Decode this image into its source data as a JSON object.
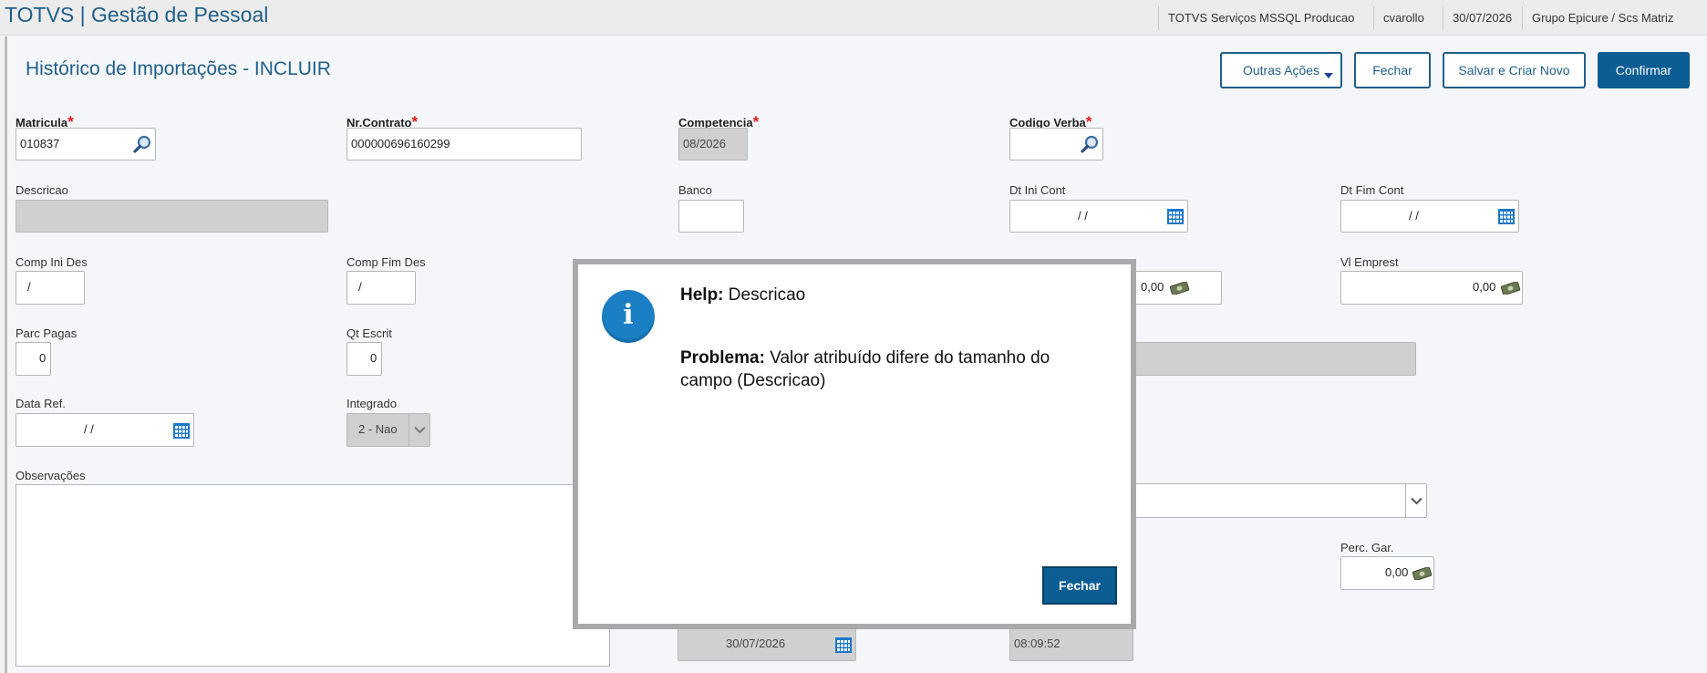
{
  "app": {
    "title": "TOTVS | Gestão de Pessoal",
    "status": [
      "TOTVS Serviços MSSQL Producao",
      "cvarollo",
      "30/07/2026",
      "Grupo Epicure / Scs Matriz"
    ]
  },
  "page": {
    "title": "Histórico de Importações - INCLUIR"
  },
  "toolbar": {
    "other_actions": "Outras Ações",
    "close": "Fechar",
    "save_new": "Salvar e Criar Novo",
    "confirm": "Confirmar"
  },
  "form": {
    "matricula": {
      "label": "Matricula",
      "value": "010837"
    },
    "nr_contrato": {
      "label": "Nr.Contrato",
      "value": "000000696160299"
    },
    "competencia": {
      "label": "Competencia",
      "value": "08/2026"
    },
    "codigo_verba": {
      "label": "Codigo Verba",
      "value": ""
    },
    "descricao": {
      "label": "Descricao",
      "value": ""
    },
    "banco": {
      "label": "Banco",
      "value": ""
    },
    "dt_ini_cont": {
      "label": "Dt Ini Cont",
      "value": "/ /"
    },
    "dt_fim_cont": {
      "label": "Dt Fim Cont",
      "value": "/ /"
    },
    "comp_ini_des": {
      "label": "Comp Ini Des",
      "value": "/"
    },
    "comp_fim_des": {
      "label": "Comp Fim Des",
      "value": "/"
    },
    "vl_prest_partial": {
      "value": "0,00"
    },
    "vl_emprest": {
      "label": "Vl Emprest",
      "value": "0,00"
    },
    "parc_pagas": {
      "label": "Parc Pagas",
      "value": "0"
    },
    "qt_escrit": {
      "label": "Qt Escrit",
      "value": "0"
    },
    "data_ref": {
      "label": "Data Ref.",
      "value": "/ /"
    },
    "integrado": {
      "label": "Integrado",
      "value": "2 - Nao"
    },
    "observacoes": {
      "label": "Observações",
      "value": ""
    },
    "perc_gar": {
      "label": "Perc. Gar.",
      "value": "0,00"
    },
    "data_bottom": {
      "value": "30/07/2026"
    },
    "hora_bottom": {
      "value": "08:09:52"
    }
  },
  "modal": {
    "help_label": "Help:",
    "help_value": "Descricao",
    "problem_label": "Problema:",
    "problem_text": "Valor atribuído difere do tamanho do campo (Descricao)",
    "close": "Fechar"
  },
  "colors": {
    "brand": "#1f5f8b",
    "primary": "#0b5d93",
    "required": "#e0161b",
    "info": "#1a7fc4"
  }
}
